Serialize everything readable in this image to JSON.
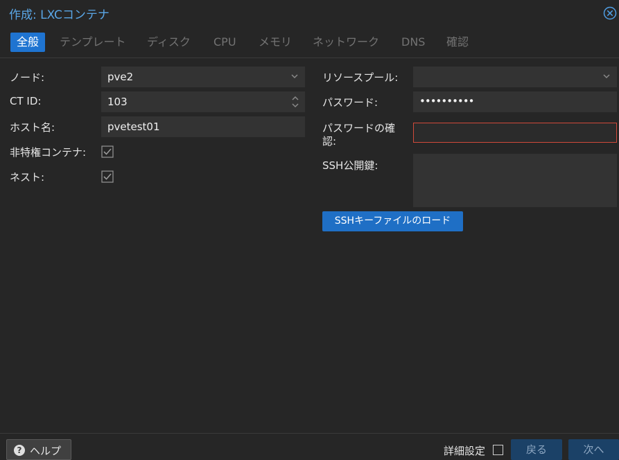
{
  "title": "作成: LXCコンテナ",
  "tabs": [
    {
      "label": "全般",
      "active": true
    },
    {
      "label": "テンプレート"
    },
    {
      "label": "ディスク"
    },
    {
      "label": "CPU"
    },
    {
      "label": "メモリ"
    },
    {
      "label": "ネットワーク"
    },
    {
      "label": "DNS"
    },
    {
      "label": "確認"
    }
  ],
  "left": {
    "node": {
      "label": "ノード:",
      "value": "pve2"
    },
    "ctid": {
      "label": "CT ID:",
      "value": "103"
    },
    "hostname": {
      "label": "ホスト名:",
      "value": "pvetest01"
    },
    "unprivileged": {
      "label": "非特権コンテナ:",
      "checked": true
    },
    "nesting": {
      "label": "ネスト:",
      "checked": true
    }
  },
  "right": {
    "pool": {
      "label": "リソースプール:",
      "value": ""
    },
    "password": {
      "label": "パスワード:",
      "value": "••••••••••"
    },
    "confirm": {
      "label_line1": "パスワードの確",
      "label_line2": "認:",
      "value": ""
    },
    "sshkey": {
      "label": "SSH公開鍵:",
      "value": ""
    },
    "load_button": "SSHキーファイルのロード"
  },
  "footer": {
    "help": "ヘルプ",
    "advanced": "詳細設定",
    "back": "戻る",
    "next": "次へ"
  },
  "colors": {
    "accent": "#1f74d1",
    "title": "#5aa6e6",
    "error_border": "#d24a3a",
    "background": "#262626",
    "field": "#333333"
  }
}
